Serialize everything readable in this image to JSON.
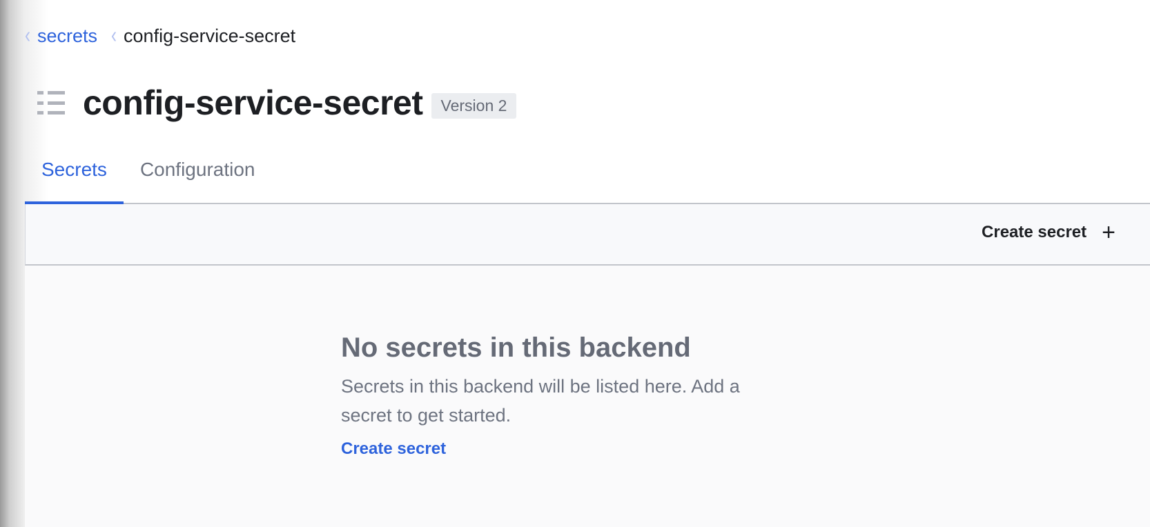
{
  "breadcrumb": {
    "parent": "secrets",
    "current": "config-service-secret"
  },
  "header": {
    "title": "config-service-secret",
    "version_badge": "Version 2"
  },
  "tabs": [
    {
      "label": "Secrets",
      "active": true
    },
    {
      "label": "Configuration",
      "active": false
    }
  ],
  "toolbar": {
    "create_label": "Create secret",
    "create_icon": "plus-icon"
  },
  "empty_state": {
    "title": "No secrets in this backend",
    "body": "Secrets in this backend will be listed here. Add a secret to get started.",
    "link": "Create secret"
  },
  "colors": {
    "accent": "#2e63dc",
    "text": "#1d1f23",
    "muted": "#656a76"
  }
}
